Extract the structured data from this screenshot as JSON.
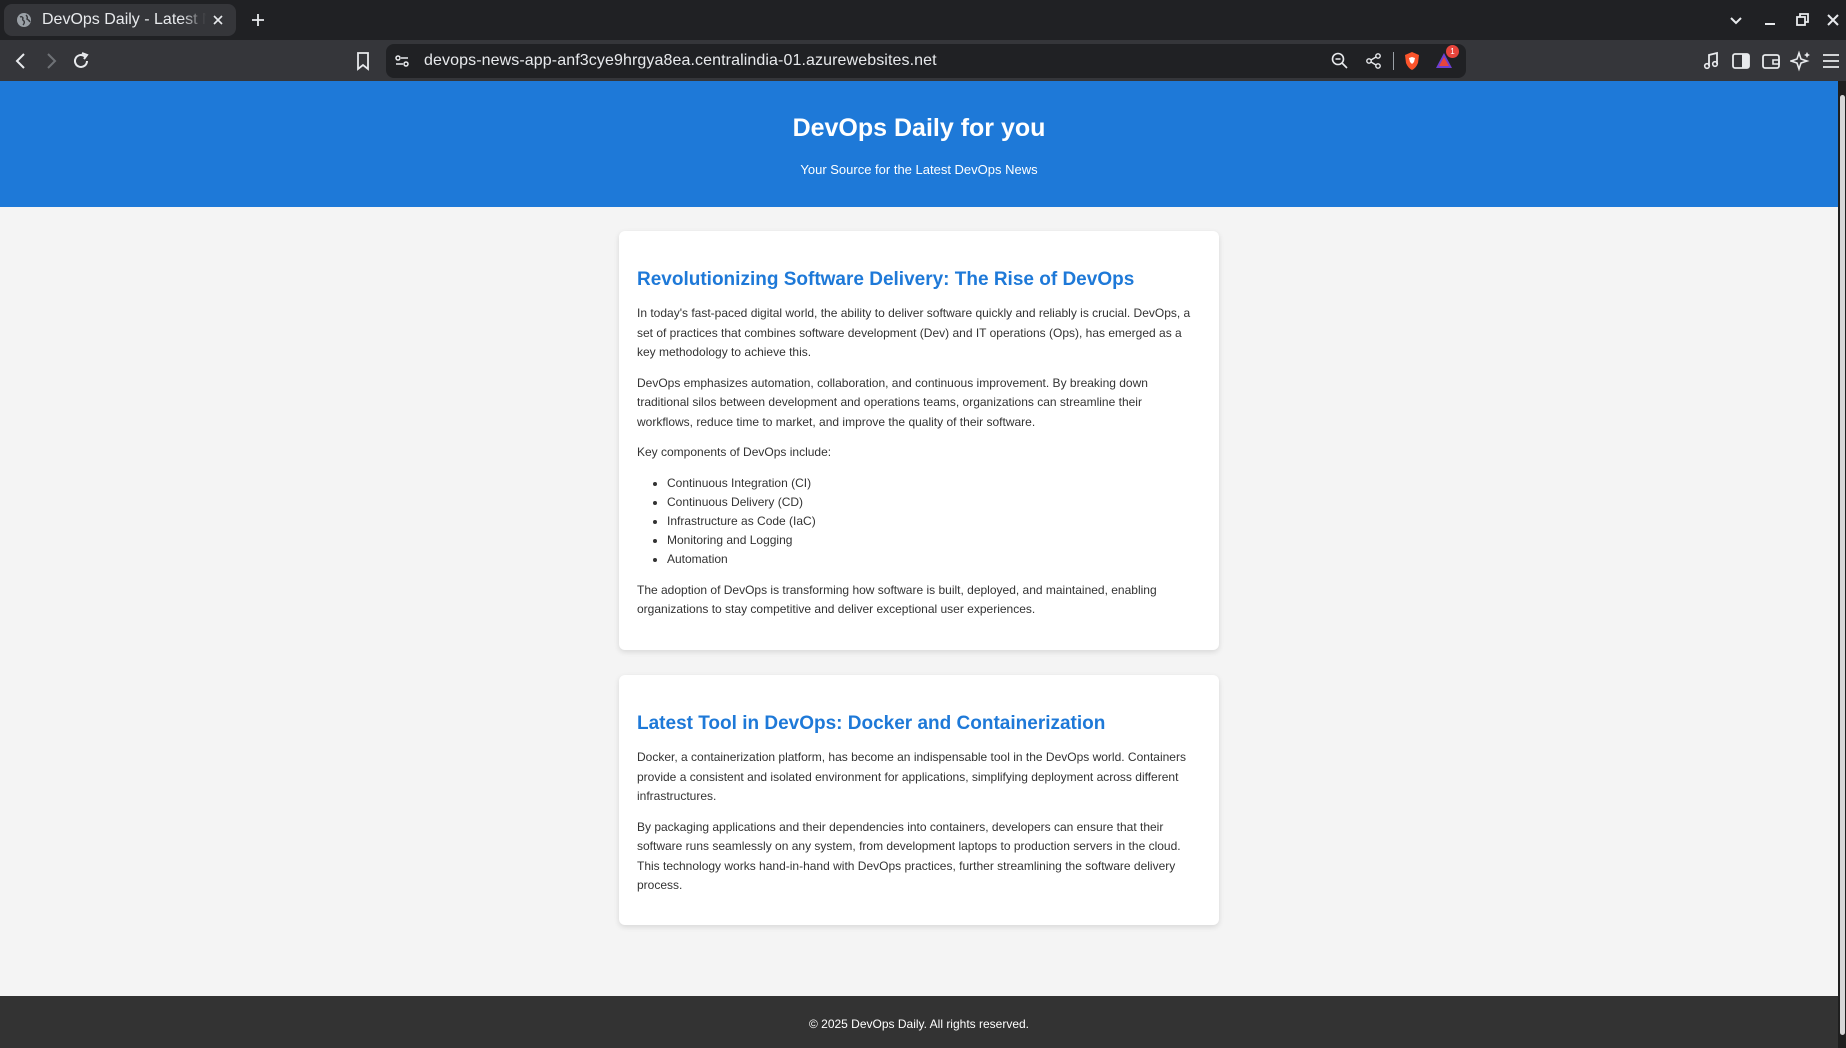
{
  "browser": {
    "tab_title": "DevOps Daily - Latest News",
    "url": "devops-news-app-anf3cye9hrgya8ea.centralindia-01.azurewebsites.net",
    "notification_count": "1"
  },
  "site": {
    "title": "DevOps Daily for you",
    "tagline": "Your Source for the Latest DevOps News",
    "footer": "© 2025 DevOps Daily. All rights reserved."
  },
  "articles": [
    {
      "title": "Revolutionizing Software Delivery: The Rise of DevOps",
      "p1": "In today's fast-paced digital world, the ability to deliver software quickly and reliably is crucial. DevOps, a set of practices that combines software development (Dev) and IT operations (Ops), has emerged as a key methodology to achieve this.",
      "p2": "DevOps emphasizes automation, collaboration, and continuous improvement. By breaking down traditional silos between development and operations teams, organizations can streamline their workflows, reduce time to market, and improve the quality of their software.",
      "p3": "Key components of DevOps include:",
      "items": [
        "Continuous Integration (CI)",
        "Continuous Delivery (CD)",
        "Infrastructure as Code (IaC)",
        "Monitoring and Logging",
        "Automation"
      ],
      "p4": "The adoption of DevOps is transforming how software is built, deployed, and maintained, enabling organizations to stay competitive and deliver exceptional user experiences."
    },
    {
      "title": "Latest Tool in DevOps: Docker and Containerization",
      "p1": "Docker, a containerization platform, has become an indispensable tool in the DevOps world. Containers provide a consistent and isolated environment for applications, simplifying deployment across different infrastructures.",
      "p2": "By packaging applications and their dependencies into containers, developers can ensure that their software runs seamlessly on any system, from development laptops to production servers in the cloud. This technology works hand-in-hand with DevOps practices, further streamlining the software delivery process."
    }
  ],
  "colors": {
    "header_bg": "#1e79d8",
    "page_bg": "#f4f4f4",
    "footer_bg": "#333333",
    "link_blue": "#1e79d8"
  }
}
